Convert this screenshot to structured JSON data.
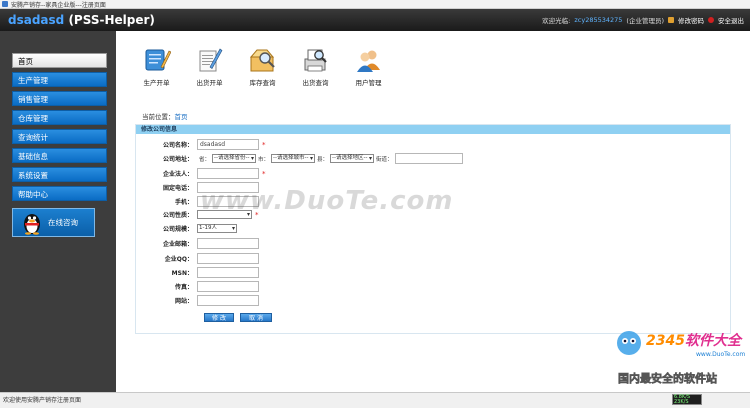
{
  "window": {
    "title": "安腾产销存--家具企业版---注册页面"
  },
  "header": {
    "brand_name": "dsadasd",
    "brand_app": "(PSS-Helper)",
    "welcome": "欢迎光临:",
    "user": "zcy285534275",
    "role": "(企业管理员)",
    "change_password": "修改密码",
    "logout": "安全退出"
  },
  "sidebar": {
    "items": [
      {
        "label": "首页"
      },
      {
        "label": "生产管理"
      },
      {
        "label": "销售管理"
      },
      {
        "label": "仓库管理"
      },
      {
        "label": "查询统计"
      },
      {
        "label": "基础信息"
      },
      {
        "label": "系统设置"
      },
      {
        "label": "帮助中心"
      }
    ],
    "chat_label": "在线咨询"
  },
  "toolbar": {
    "items": [
      {
        "label": "生产开单",
        "icon": "production-order-icon"
      },
      {
        "label": "出货开单",
        "icon": "shipping-order-icon"
      },
      {
        "label": "库存查询",
        "icon": "inventory-search-icon"
      },
      {
        "label": "出货查询",
        "icon": "shipping-search-icon"
      },
      {
        "label": "用户管理",
        "icon": "user-management-icon"
      }
    ]
  },
  "breadcrumb": {
    "prefix": "当前位置：",
    "link": "首页"
  },
  "form": {
    "title": "修改公司信息",
    "company_name": {
      "label": "公司名称：",
      "value": "dsadasd",
      "required": "*"
    },
    "address": {
      "label": "公司地址：",
      "province_label": "省：",
      "province_value": "--请选择省份--",
      "city_label": "市：",
      "city_value": "--请选择城市--",
      "district_label": "县：",
      "district_value": "--请选择地区--",
      "street_label": "街道："
    },
    "legal_person": {
      "label": "企业法人：",
      "value": "",
      "required": "*"
    },
    "phone": {
      "label": "固定电话：",
      "value": ""
    },
    "mobile": {
      "label": "手机：",
      "value": ""
    },
    "nature": {
      "label": "公司性质：",
      "value": "",
      "required": "*"
    },
    "scale": {
      "label": "公司规模：",
      "value": "1-19人"
    },
    "email": {
      "label": "企业邮箱：",
      "value": ""
    },
    "qq": {
      "label": "企业QQ：",
      "value": ""
    },
    "msn": {
      "label": "MSN：",
      "value": ""
    },
    "fax": {
      "label": "传真：",
      "value": ""
    },
    "website": {
      "label": "网站：",
      "value": ""
    },
    "submit_label": "修 改",
    "cancel_label": "取 消"
  },
  "statusbar": {
    "text": "欢迎使用安腾产销存注册页面",
    "net_up": "6.8K/S",
    "net_down": "23K/S"
  },
  "watermark": {
    "duote": "www.DuoTe.com",
    "logo_num": "2345",
    "logo_brand": "软件大全",
    "logo_url": "www.DuoTe.com",
    "logo_slogan": "国内最安全的软件站"
  },
  "colors": {
    "header_bg": "#1a1a1a",
    "sidebar_bg": "#3d3d3d",
    "nav_blue": "#0a6cc4",
    "panel_head": "#8fd0f2",
    "brand_blue": "#4aa3ff"
  }
}
